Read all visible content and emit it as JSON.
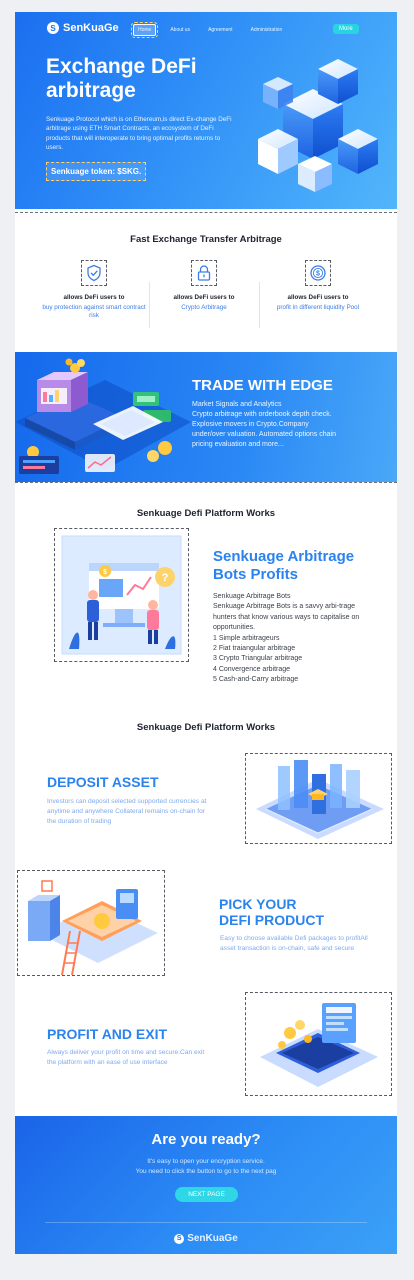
{
  "header": {
    "brand": "SenKuaGe",
    "nav": [
      "Home",
      "About us",
      "Agreement",
      "Administration"
    ],
    "more_label": "More"
  },
  "hero": {
    "title": "Exchange DeFi arbitrage",
    "description": "Senkuage Protocol which is on Ethereum,is direct Ex-change DeFi arbitrage using ETH Smart Contracts, an ecosystem of DeFi products that will interoperate to bring optimal profits returns to users.",
    "token": "Senkuage token: $SKG."
  },
  "features": {
    "title": "Fast Exchange Transfer Arbitrage",
    "items": [
      {
        "icon": "shield-check-icon",
        "title": "allows DeFi users to",
        "text": "buy protection against smart contract risk"
      },
      {
        "icon": "padlock-icon",
        "title": "allows DeFi users to",
        "text": "Crypto Arbitrage"
      },
      {
        "icon": "dollar-coin-icon",
        "title": "allows DeFi users to",
        "text": "profit in different liquidity Pool"
      }
    ]
  },
  "trade": {
    "title": "TRADE WITH EDGE",
    "lines": [
      "Market Signals and Analytics",
      "Crypto arbitrage with orderbook depth check.",
      "Explosive movers in Crypto.Company",
      "under/over valuation. Automated options chain",
      "pricing evaluation and more..."
    ]
  },
  "platform": {
    "title": "Senkuage Defi Platform Works",
    "heading": "Senkuage Arbitrage Bots Profits",
    "subheading": "Senkuage Arbitrage Bots",
    "intro": "Senkuage Arbitrage Bots is a savvy arbi-trage hunters that know various ways to capitalise on opportunities.",
    "list": [
      "1 Simple arbitrageurs",
      "2 Fiat traiangular arbitrage",
      "3 Crypto Triangular arbitrage",
      "4 Convergence arbitrage",
      "5 Cash-and-Carry arbitrage"
    ]
  },
  "steps": {
    "title": "Senkuage Defi Platform Works",
    "deposit": {
      "title": "DEPOSIT ASSET",
      "description": "Investors can deposit selected supported currencies at anytime and anywhere Collateral remains on-chain for the duration of trading"
    },
    "pick": {
      "title_line1": "PICK YOUR",
      "title_line2": "DEFI PRODUCT",
      "description": "Easy to choose available Defi packages to profitAll asset transaction is on-chain, safe and secure"
    },
    "profit": {
      "title": "PROFIT AND EXIT",
      "description": "Always deliver your profit on time and secure.Can exit the platform with an ease of use interface"
    }
  },
  "footer": {
    "title": "Are you ready?",
    "line1": "It's easy to open your encryption service.",
    "line2": "You need to click the button to go to the next pag",
    "button": "NEXT PAGE",
    "brand": "SenKuaGe"
  },
  "colors": {
    "primary_blue": "#1b6ff0",
    "heading_blue": "#2b83ee",
    "accent_cyan": "#2fd6e6"
  }
}
